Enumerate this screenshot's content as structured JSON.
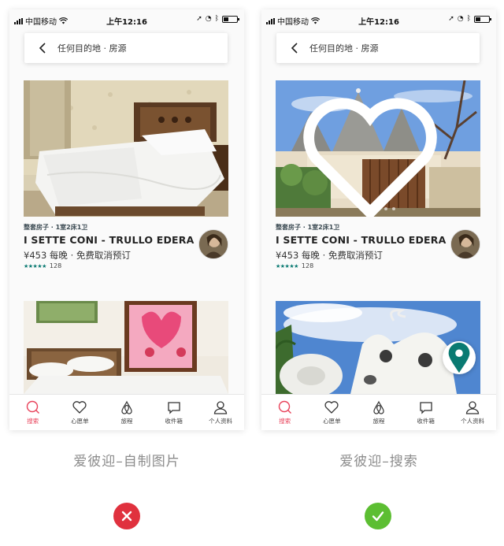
{
  "status_bar": {
    "carrier": "中国移动",
    "time": "上午12:16"
  },
  "search": {
    "placeholder": "任何目的地 · 房源"
  },
  "listing": {
    "type": "整套房子 · 1室2床1卫",
    "title": "I SETTE CONI - TRULLO EDERA",
    "price": "¥453 每晚 · 免费取消预订",
    "stars": "★★★★★",
    "reviews": "128"
  },
  "tabs": [
    {
      "label": "搜索",
      "icon": "search-icon"
    },
    {
      "label": "心愿单",
      "icon": "heart-icon"
    },
    {
      "label": "旅程",
      "icon": "airbnb-logo-icon"
    },
    {
      "label": "收件箱",
      "icon": "message-icon"
    },
    {
      "label": "个人资料",
      "icon": "user-icon"
    }
  ],
  "left": {
    "caption": "爱彼迎–自制图片",
    "verdict": "incorrect"
  },
  "right": {
    "caption": "爱彼迎–搜索",
    "verdict": "correct"
  },
  "colors": {
    "accent": "#e8425a",
    "teal": "#0a7a72",
    "bad": "#e0313e",
    "good": "#5cbe32"
  }
}
